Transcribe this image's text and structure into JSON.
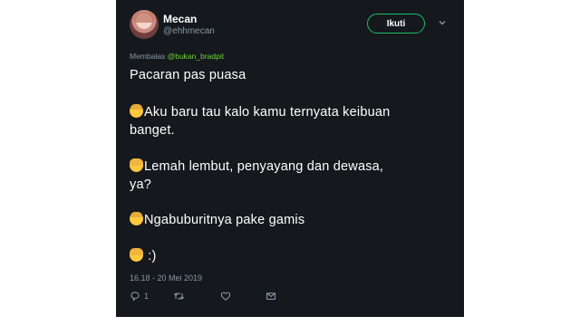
{
  "tweet": {
    "user": {
      "name": "Mecan",
      "handle": "@ehhmecan"
    },
    "follow_label": "Ikuti",
    "reply_prefix": "Membalas",
    "reply_mention": "@bukan_bradpit",
    "lines": [
      "Pacaran pas puasa",
      "Aku baru tau kalo kamu ternyata keibuan",
      "banget.",
      "Lemah lembut, penyayang dan dewasa,",
      "ya?",
      "Ngabuburitnya pake gamis",
      ":)"
    ],
    "timestamp": "16.18 - 20 Mei 2019",
    "reply_count": "1"
  },
  "icons": {
    "more": "chevron-down-icon",
    "reply": "reply-icon",
    "retweet": "retweet-icon",
    "like": "heart-icon",
    "message": "envelope-icon"
  },
  "colors": {
    "card_background": "#15181d",
    "follow_border": "#17bf63",
    "muted_text": "#8899a6",
    "mention": "#6fd43a"
  }
}
